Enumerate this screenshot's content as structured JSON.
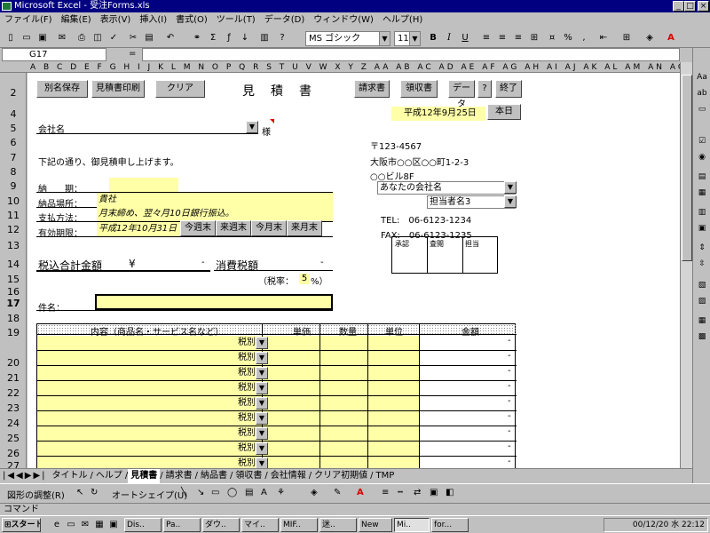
{
  "titlebar": {
    "title": "Microsoft Excel - 受注Forms.xls",
    "min": "_",
    "max": "□",
    "close": "×"
  },
  "menu": [
    "ファイル(F)",
    "編集(E)",
    "表示(V)",
    "挿入(I)",
    "書式(O)",
    "ツール(T)",
    "データ(D)",
    "ウィンドウ(W)",
    "ヘルプ(H)"
  ],
  "toolbar": {
    "font": "MS ゴシック",
    "size": "11",
    "bold": "B",
    "italic": "I",
    "underline": "U",
    "percent": "%"
  },
  "formula": {
    "cell": "G17",
    "eq": "="
  },
  "columns": "A B C D E F G H I J K L M N O P Q R S T U V W X Y Z AA AB AC AD AE AF AG AH AI AJ AK AL AM AN AO AP AQ AR AS AT AU AV AW AX AY AZ BA BB",
  "rows": [
    "2",
    "4",
    "5",
    "6",
    "7",
    "8",
    "9",
    "10",
    "11",
    "12",
    "13",
    "14",
    "15",
    "16",
    "17",
    "18",
    "19",
    "20",
    "21",
    "22",
    "23",
    "24",
    "25",
    "26",
    "27"
  ],
  "buttons": {
    "save_as": "別名保存",
    "print": "見積書印刷",
    "clear": "クリア",
    "invoice": "請求書",
    "receipt": "領収書",
    "data": "データ",
    "help": "?",
    "end": "終了",
    "today": "本日"
  },
  "form": {
    "title": "見　積　書",
    "date": "平成12年9月25日",
    "company": "会社名",
    "honorific": "様",
    "greeting": "下記の通り、御見積申し上げます。",
    "delivery_label": "納　　期：",
    "place_label": "納品場所：",
    "place_value": "貴社",
    "payment_label": "支払方法：",
    "payment_value": "月末締め、翌々月10日銀行振込。",
    "expiry_label": "有効期限：",
    "expiry_value": "平成12年10月31日",
    "period_btns": [
      "今週末",
      "来週末",
      "今月末",
      "来月末"
    ],
    "total_label": "税込合計金額",
    "yen": "¥",
    "total_value": "-",
    "tax_label": "消費税額",
    "tax_value": "-",
    "rate_label": "（税率：",
    "rate_value": "5",
    "rate_unit": "%）",
    "subject_label": "件名："
  },
  "sender": {
    "zip": "〒123-4567",
    "address": "大阪市○○区○○町1-2-3",
    "building": "○○ビル8F",
    "company": "あなたの会社名",
    "person": "担当者名3",
    "tel": "TEL:　06-6123-1234",
    "fax": "FAX:　06-6123-1235",
    "stamps": [
      "承認",
      "査閲",
      "担当"
    ]
  },
  "table": {
    "headers": [
      "内容（商品名・サービス名など）",
      "単価",
      "数量",
      "単位",
      "金額"
    ],
    "tax": "税別",
    "amount": "-"
  },
  "sheet_tabs": [
    "タイトル",
    "ヘルプ",
    "見積書",
    "請求書",
    "納品書",
    "領収書",
    "会社情報",
    "クリア初期値",
    "TMP"
  ],
  "drawbar": {
    "draw": "図形の調整(R)",
    "autoshape": "オートシェイプ(U)"
  },
  "status": "コマンド",
  "taskbar": {
    "start": "スタート",
    "tasks": [
      "Dis..",
      "Pa..",
      "ダウ..",
      "マイ..",
      "MIF..",
      "迷..",
      "New",
      "Mi..",
      "for..."
    ],
    "clock": "00/12/20 水 22:12"
  }
}
